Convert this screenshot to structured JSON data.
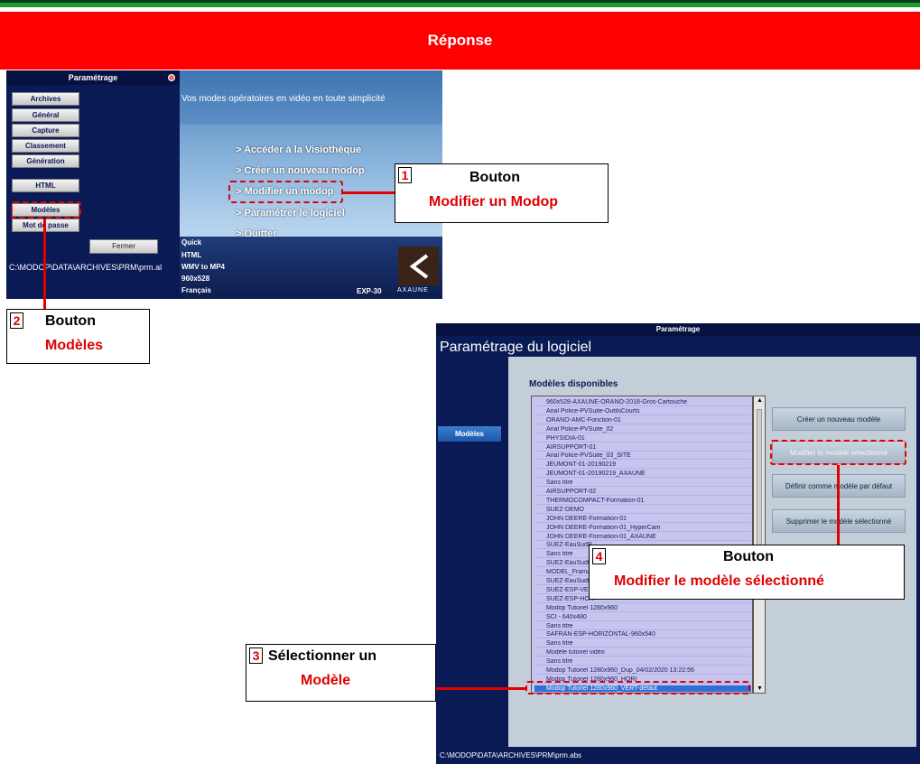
{
  "header": {
    "title": "Réponse"
  },
  "screen1": {
    "panel_title": "Paramétrage",
    "buttons": [
      "Archives",
      "Général",
      "Capture",
      "Classement",
      "Génération",
      "HTML",
      "Modèles",
      "Mot de passe"
    ],
    "close_button": "Fermer",
    "path": "C:\\MODOP\\DATA\\ARCHIVES\\PRM\\prm.al",
    "tagline": "Vos modes opératoires en vidéo en toute simplicité",
    "menu": [
      "> Accéder à la Visiothèque",
      "> Créer un nouveau modop",
      "> Modifier un modop",
      "> Paramétrer le logiciel",
      "> Quitter"
    ],
    "info": [
      "Quick",
      "HTML",
      "WMV to MP4",
      "960x528",
      "Français"
    ],
    "version": "EXP-30",
    "logo_text": "AXAUNE"
  },
  "callouts": {
    "c1": {
      "number": "1",
      "line1": "Bouton",
      "line2": "Modifier un Modop"
    },
    "c2": {
      "number": "2",
      "line1": "Bouton",
      "line2": "Modèles"
    },
    "c3": {
      "number": "3",
      "line1": "Sélectionner un",
      "line2": "Modèle"
    },
    "c4": {
      "number": "4",
      "line1": "Bouton",
      "line2": "Modifier le modèle sélectionné"
    }
  },
  "screen2": {
    "window_title": "Paramétrage",
    "heading": "Paramétrage du logiciel",
    "tab": "Modèles",
    "list_title": "Modèles disponibles",
    "models": [
      "960x528-AXAUNE-ORANO-2018-Gros-Cartouche",
      "Arial Police-PVSuite-OutilsCourts",
      "ORANO-AMC-Fonction-01",
      "Arial Police-PVSuite_02",
      "PHYSIDIA-01",
      "AIRSUPPORT-01",
      "Arial Police-PVSuite_03_SITE",
      "JEUMONT-01-20190219",
      "JEUMONT-01-20190219_AXAUNE",
      "Sans titre",
      "AIRSUPPORT-02",
      "THERMOCOMPACT-Formation-01",
      "SUEZ-DEMO",
      "JOHN DEERE-Formation-01",
      "JOHN DEERE-Formation-01_HyperCam",
      "JOHN DEERE-Formation-01_AXAUNE",
      "SUEZ-EauSudP",
      "Sans titre",
      "SUEZ-EauSudP",
      "MODEL_Framat",
      "SUEZ-EauSudP",
      "SUEZ-ESP-VER",
      "SUEZ-ESP-HOR",
      "Modop Tutoriel 1280x960",
      "SCI - 640x480",
      "Sans titre",
      "SAFRAN-ESP-HORIZONTAL-960x540",
      "Sans titre",
      "Modèle tutoriel vidéo",
      "Sans titre",
      "Modop Tutoriel 1280x960_Dup_04/02/2020 13:22:56",
      "Modop Tutoriel 1280x960_HORI",
      "Modop Tutoriel 1280x960_VERT-défaut"
    ],
    "selected_index": 32,
    "actions": [
      "Créer un nouveau modèle",
      "Modifier le modèle sélectionné",
      "Définir comme modèle par défaut",
      "Supprimer le modèle sélectionné"
    ],
    "path": "C:\\MODOP\\DATA\\ARCHIVES\\PRM\\prm.abs"
  }
}
